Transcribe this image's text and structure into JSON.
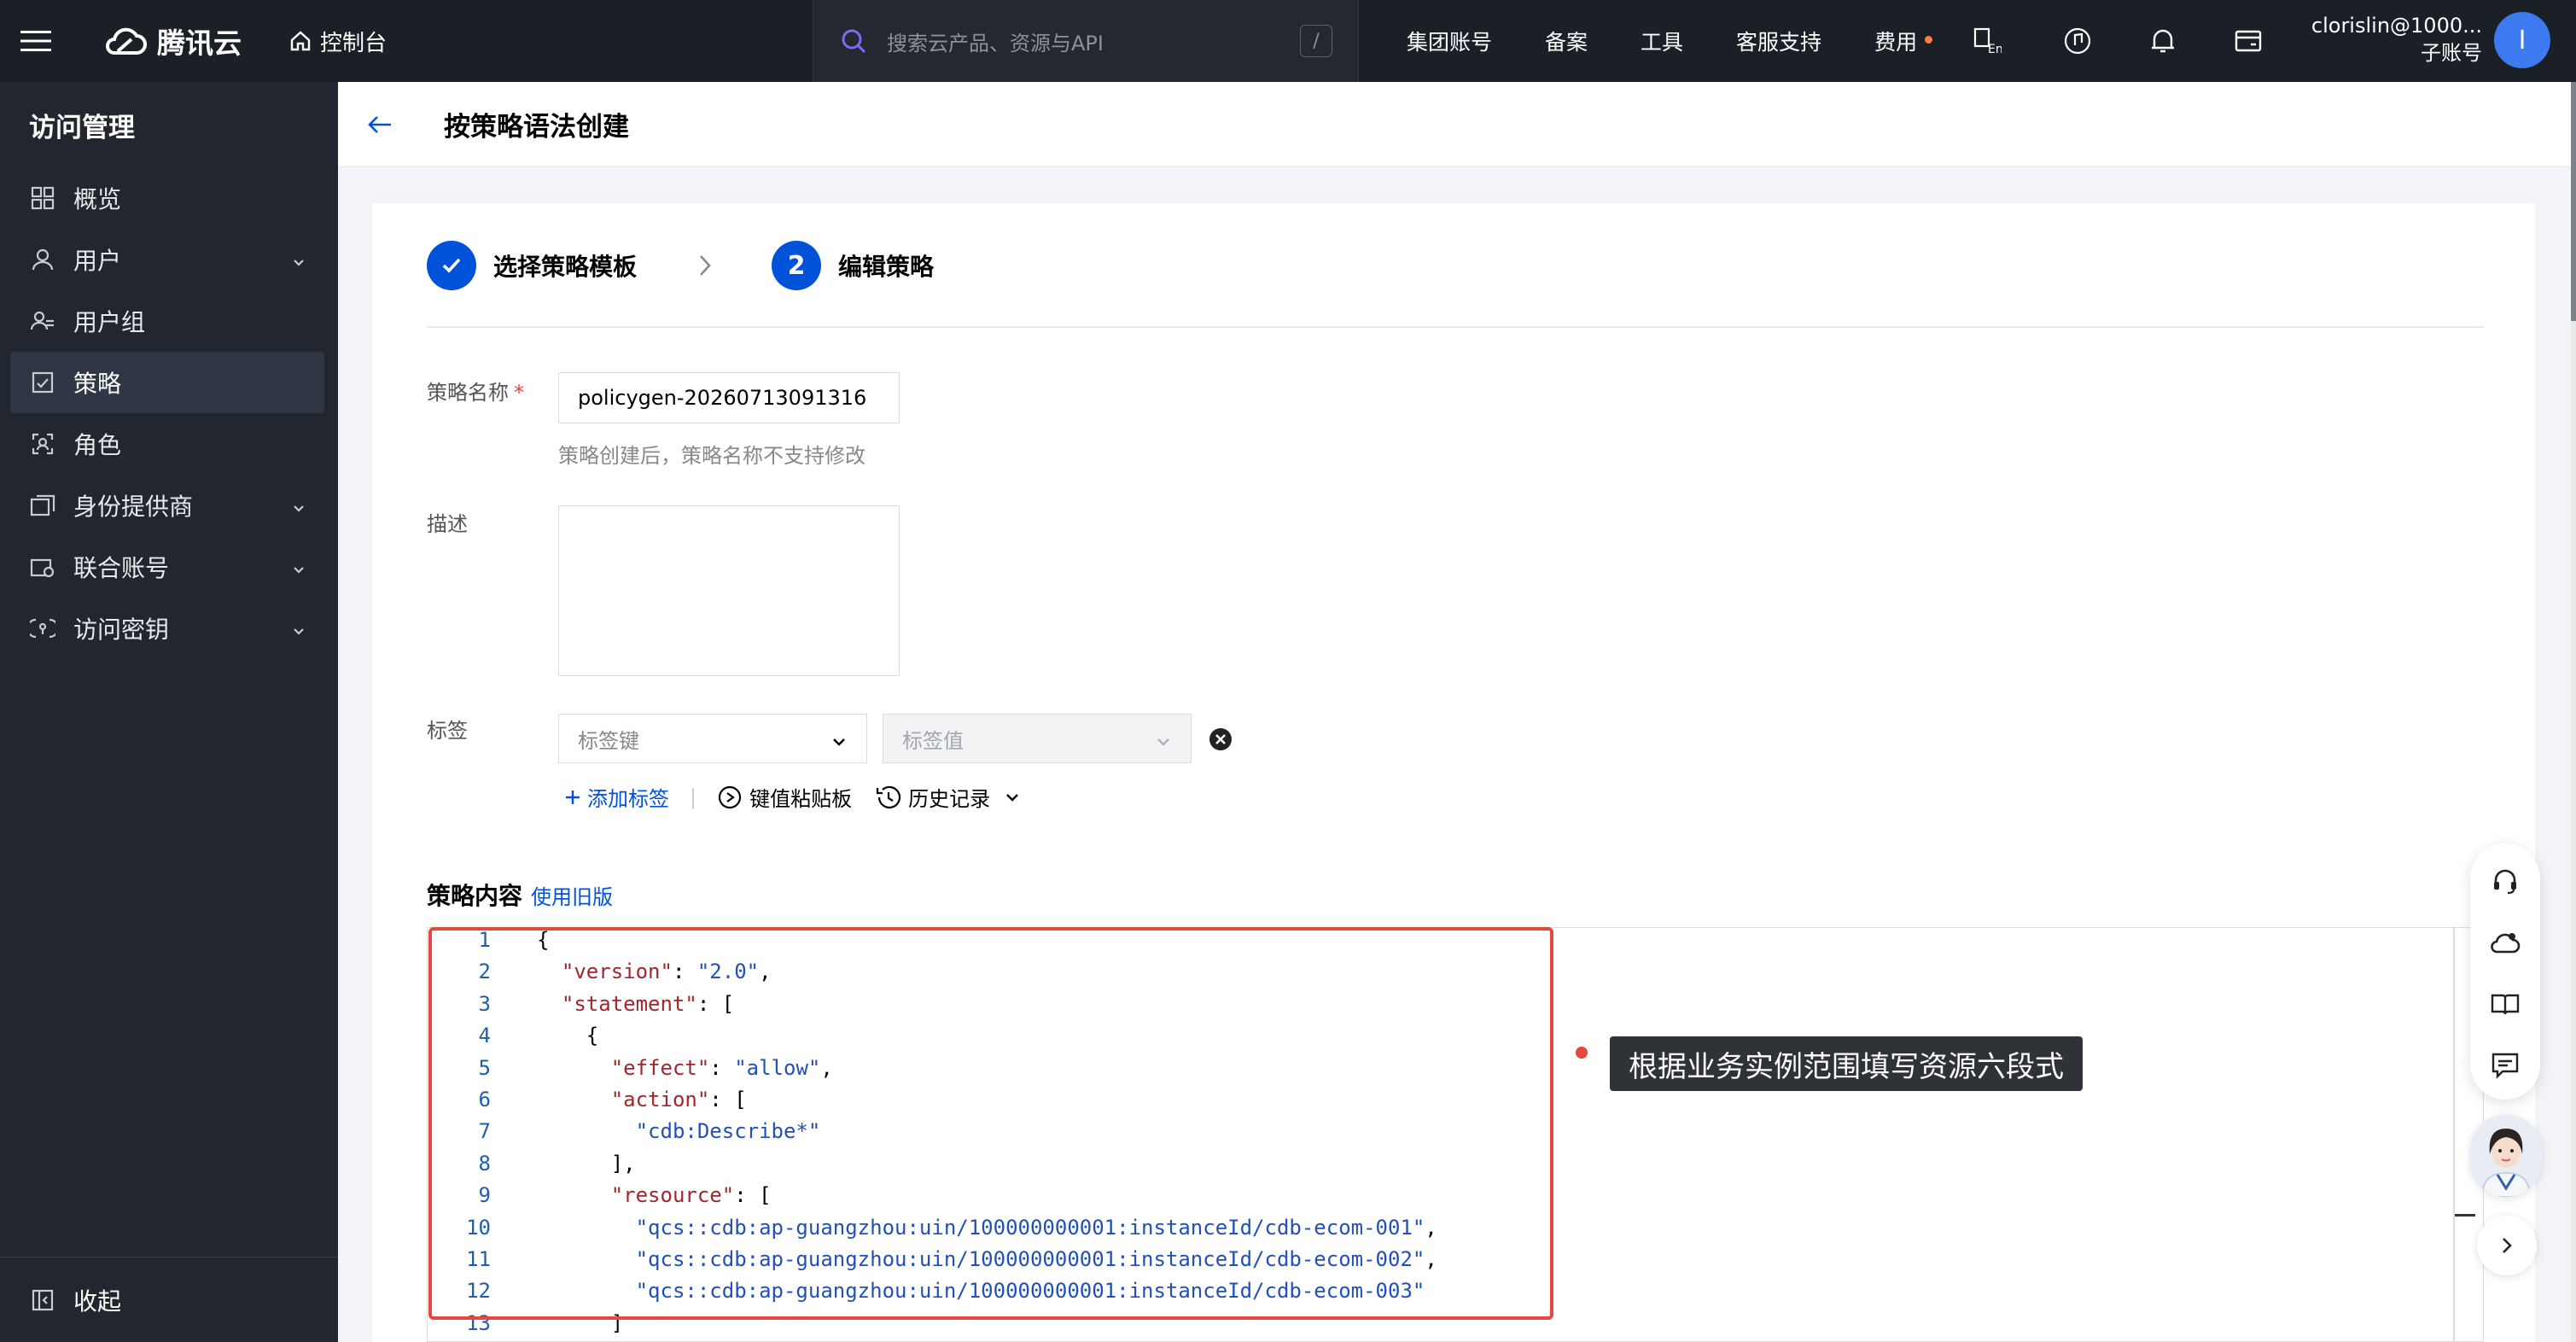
{
  "topbar": {
    "logo": "腾讯云",
    "console": "控制台",
    "search_placeholder": "搜索云产品、资源与API",
    "search_shortcut": "/",
    "nav": [
      "集团账号",
      "备案",
      "工具",
      "客服支持",
      "费用"
    ],
    "user_name": "clorislin@1000...",
    "user_role": "子账号",
    "avatar_letter": "I"
  },
  "sidebar": {
    "title": "访问管理",
    "items": [
      {
        "label": "概览",
        "icon": "grid-icon"
      },
      {
        "label": "用户",
        "icon": "user-icon",
        "expand": true
      },
      {
        "label": "用户组",
        "icon": "user-group-icon"
      },
      {
        "label": "策略",
        "icon": "policy-icon",
        "active": true
      },
      {
        "label": "角色",
        "icon": "role-icon"
      },
      {
        "label": "身份提供商",
        "icon": "idp-icon",
        "expand": true
      },
      {
        "label": "联合账号",
        "icon": "federated-account-icon",
        "expand": true
      },
      {
        "label": "访问密钥",
        "icon": "key-icon",
        "expand": true
      }
    ],
    "collapse": "收起"
  },
  "header": {
    "title": "按策略语法创建"
  },
  "steps": [
    {
      "label": "选择策略模板",
      "state": "done"
    },
    {
      "number": "2",
      "label": "编辑策略",
      "state": "current"
    }
  ],
  "form": {
    "name_label": "策略名称",
    "required_mark": "*",
    "name_value": "policygen-20260713091316",
    "name_hint": "策略创建后，策略名称不支持修改",
    "desc_label": "描述",
    "desc_value": "",
    "tag_label": "标签",
    "tag_key_placeholder": "标签键",
    "tag_value_placeholder": "标签值",
    "add_tag": "添加标签",
    "separator": "|",
    "clipboard": "键值粘贴板",
    "history": "历史记录"
  },
  "policy": {
    "title": "策略内容",
    "legacy_link": "使用旧版",
    "code_lines": [
      "{",
      "  \"version\": \"2.0\",",
      "  \"statement\": [",
      "    {",
      "      \"effect\": \"allow\",",
      "      \"action\": [",
      "        \"cdb:Describe*\"",
      "      ],",
      "      \"resource\": [",
      "        \"qcs::cdb:ap-guangzhou:uin/100000000001:instanceId/cdb-ecom-001\",",
      "        \"qcs::cdb:ap-guangzhou:uin/100000000001:instanceId/cdb-ecom-002\",",
      "        \"qcs::cdb:ap-guangzhou:uin/100000000001:instanceId/cdb-ecom-003\"",
      "      ]",
      "    }"
    ],
    "annotation": "根据业务实例范围填写资源六段式"
  },
  "colors": {
    "accent": "#0052d9",
    "highlight": "#e5483f",
    "topbar": "#1b1f26",
    "sidebar": "#22262e"
  }
}
